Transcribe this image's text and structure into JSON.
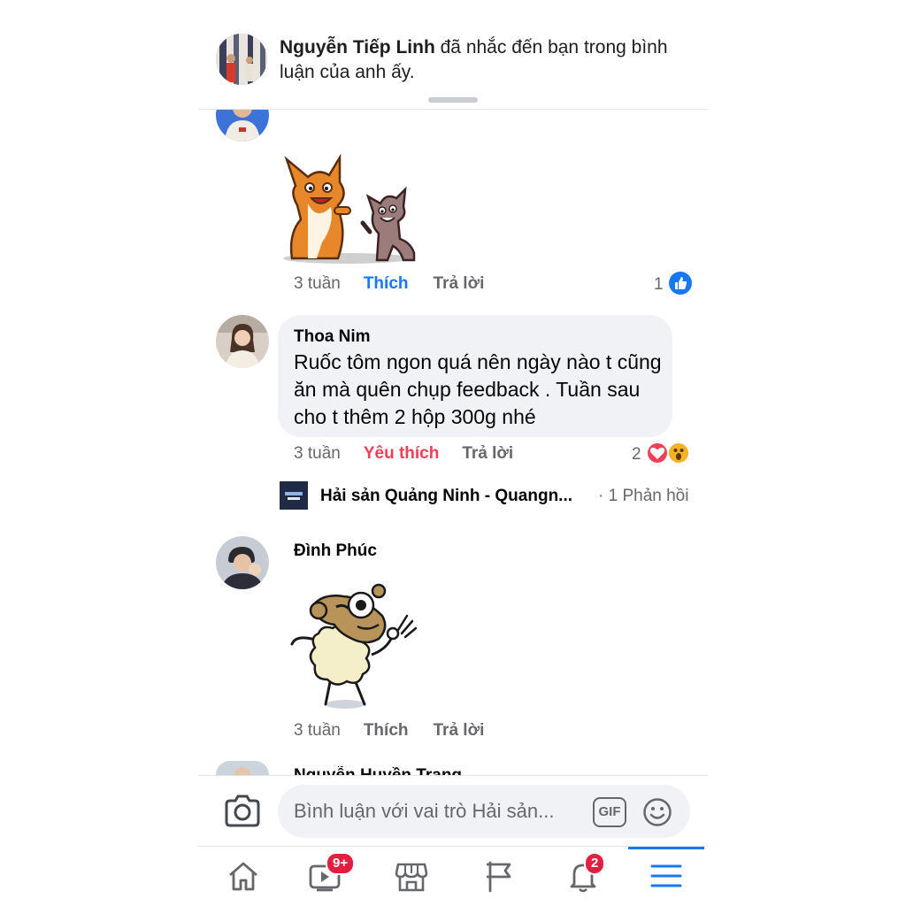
{
  "notification": {
    "actor": "Nguyễn Tiếp Linh",
    "message": " đã nhắc đến bạn trong bình luận của anh ấy."
  },
  "comments": [
    {
      "type": "sticker",
      "sticker": "corgi-and-dog-sticker",
      "time": "3 tuần",
      "like_label": "Thích",
      "reply_label": "Trả lời",
      "reaction_count": "1",
      "reactions": [
        "like"
      ]
    },
    {
      "type": "text",
      "author": "Thoa Nim",
      "text": "Ruốc tôm ngon quá nên ngày nào t cũng ăn mà quên chụp feedback . Tuần sau cho t thêm 2 hộp 300g nhé",
      "time": "3 tuần",
      "like_label": "Yêu thích",
      "reply_label": "Trả lời",
      "reaction_count": "2",
      "reactions": [
        "love",
        "wow"
      ],
      "reply_preview": {
        "author": "Hải sản Quảng Ninh - Quangn...",
        "count": "· 1 Phản hồi"
      }
    },
    {
      "type": "sticker",
      "author": "Đình Phúc",
      "sticker": "sheep-ok-sticker",
      "time": "3 tuần",
      "like_label": "Thích",
      "reply_label": "Trả lời"
    },
    {
      "type": "cutoff",
      "author": "Nguyễn Huyền Trang"
    }
  ],
  "composer": {
    "placeholder": "Bình luận với vai trò Hải sản...",
    "gif_label": "GIF"
  },
  "tabbar": {
    "items": [
      {
        "name": "home",
        "icon": "home-icon"
      },
      {
        "name": "watch",
        "icon": "video-icon",
        "badge": "9+"
      },
      {
        "name": "marketplace",
        "icon": "store-icon"
      },
      {
        "name": "pages",
        "icon": "flag-icon"
      },
      {
        "name": "notifications",
        "icon": "bell-icon",
        "badge": "2"
      },
      {
        "name": "menu",
        "icon": "menu-icon",
        "active": true
      }
    ]
  },
  "colors": {
    "accent": "#1877f2",
    "love": "#f33e58",
    "badge": "#e41e3f",
    "secondary_text": "#65676b",
    "bubble": "#f0f2f5"
  }
}
